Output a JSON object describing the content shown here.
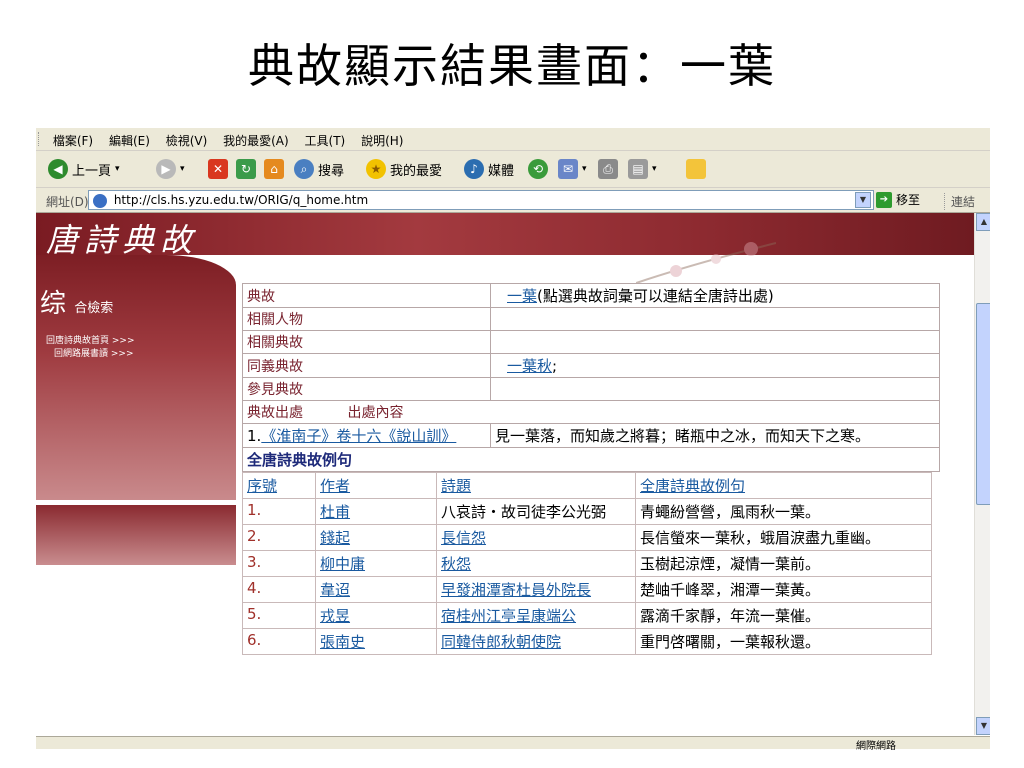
{
  "slide_title": "典故顯示結果畫面：一葉",
  "browser": {
    "menu": [
      "檔案(F)",
      "編輯(E)",
      "檢視(V)",
      "我的最愛(A)",
      "工具(T)",
      "說明(H)"
    ],
    "toolbar": {
      "back": "上一頁",
      "search": "搜尋",
      "favorites": "我的最愛",
      "media": "媒體"
    },
    "address_label": "網址(D)",
    "url": "http://cls.hs.yzu.edu.tw/ORIG/q_home.htm",
    "go_label": "移至",
    "links_label": "連結",
    "status_zone": "網際網路"
  },
  "page": {
    "banner_title": "唐詩典故",
    "side_logo": "综",
    "side_logo_sub": "合檢索",
    "side_links": [
      "回唐詩典故首頁 >>>",
      "回網路展書讀 >>>"
    ],
    "info": {
      "labels": [
        "典故",
        "相關人物",
        "相關典故",
        "同義典故",
        "參見典故"
      ],
      "dianfu_link": "一葉",
      "dianfu_note": "(點選典故詞彙可以連結全唐詩出處)",
      "synonym_link": "一葉秋",
      "synonym_suffix": ";"
    },
    "source_header": {
      "col1": "典故出處",
      "col2": "出處內容"
    },
    "source": {
      "index": "1.",
      "ref": "《淮南子》卷十六《說山訓》",
      "text": "見一葉落，而知歲之將暮；睹瓶中之冰，而知天下之寒。"
    },
    "examples_title": "全唐詩典故例句",
    "examples_headers": [
      "序號",
      "作者",
      "詩題",
      "全唐詩典故例句"
    ],
    "examples": [
      {
        "n": "1.",
        "author": "杜甫",
        "title": "八哀詩・故司徒李公光弼",
        "title_link": false,
        "line": "青蠅紛營營，風雨秋一葉。"
      },
      {
        "n": "2.",
        "author": "錢起",
        "title": "長信怨",
        "title_link": true,
        "line": "長信螢來一葉秋，蛾眉淚盡九重幽。"
      },
      {
        "n": "3.",
        "author": "柳中庸",
        "title": "秋怨",
        "title_link": true,
        "line": "玉樹起涼煙，凝情一葉前。"
      },
      {
        "n": "4.",
        "author": "韋迢",
        "title": "早發湘潭寄杜員外院長",
        "title_link": true,
        "line": "楚岫千峰翠，湘潭一葉黃。"
      },
      {
        "n": "5.",
        "author": "戎昱",
        "title": "宿桂州江亭呈康端公",
        "title_link": true,
        "line": "露滴千家靜，年流一葉催。"
      },
      {
        "n": "6.",
        "author": "張南史",
        "title": "同韓侍郎秋朝使院",
        "title_link": true,
        "line": "重門啓曙關，一葉報秋還。"
      }
    ]
  }
}
